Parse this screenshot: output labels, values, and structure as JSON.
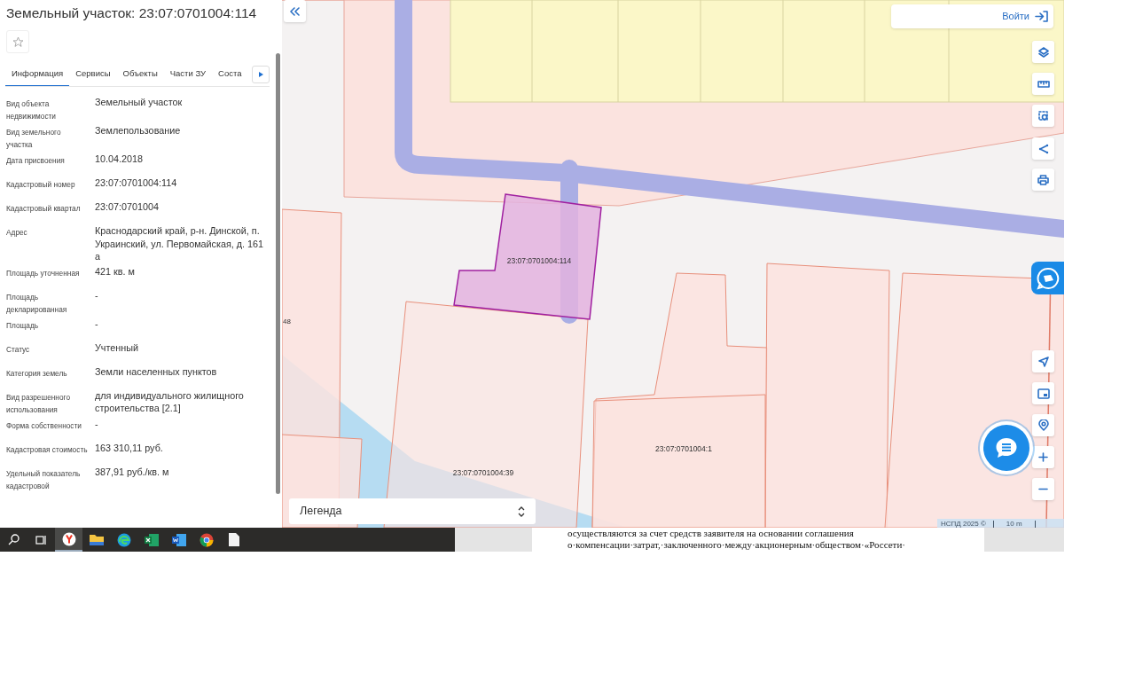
{
  "panel": {
    "title": "Земельный участок: 23:07:0701004:114",
    "favorite": false,
    "tabs": [
      {
        "label": "Информация",
        "selected": true
      },
      {
        "label": "Сервисы",
        "selected": false
      },
      {
        "label": "Объекты",
        "selected": false
      },
      {
        "label": "Части ЗУ",
        "selected": false
      },
      {
        "label": "Соста",
        "selected": false
      }
    ],
    "properties": [
      {
        "label": "Вид объекта недвижимости",
        "value": "Земельный участок"
      },
      {
        "label": "Вид земельного участка",
        "value": "Землепользование"
      },
      {
        "label": "Дата присвоения",
        "value": "10.04.2018"
      },
      {
        "label": "Кадастровый номер",
        "value": "23:07:0701004:114"
      },
      {
        "label": "Кадастровый квартал",
        "value": "23:07:0701004"
      },
      {
        "label": "Адрес",
        "value": "Краснодарский край, р-н. Динской, п. Украинский, ул. Первомайская, д. 161 а"
      },
      {
        "label": "Площадь уточненная",
        "value": "421 кв. м"
      },
      {
        "label": "Площадь декларированная",
        "value": "-"
      },
      {
        "label": "Площадь",
        "value": "-"
      },
      {
        "label": "Статус",
        "value": "Учтенный"
      },
      {
        "label": "Категория земель",
        "value": "Земли населенных пунктов"
      },
      {
        "label": "Вид разрешенного использования",
        "value": "для индивидуального жилищного строительства [2.1]"
      },
      {
        "label": "Форма собственности",
        "value": "-"
      },
      {
        "label": "Кадастровая стоимость",
        "value": "163 310,11 руб."
      },
      {
        "label": "Удельный показатель кадастровой",
        "value": "387,91 руб./кв. м"
      }
    ]
  },
  "map": {
    "login_button": "Войти",
    "edge_label": "48",
    "parcels": [
      {
        "label": "23:07:0701004:114",
        "selected": true
      },
      {
        "label": "23:07:0701004:39",
        "selected": false
      },
      {
        "label": "23:07:0701004:1",
        "selected": false
      }
    ],
    "legend": "Легенда",
    "attribution": "НСПД 2025 ©",
    "scale": "10 m"
  },
  "taskbar": {
    "apps": [
      {
        "kind": "search",
        "selected": false
      },
      {
        "kind": "taskview",
        "selected": false
      },
      {
        "kind": "yandex",
        "selected": true
      },
      {
        "kind": "folder",
        "selected": false
      },
      {
        "kind": "edge",
        "selected": false
      },
      {
        "kind": "excel",
        "selected": false
      },
      {
        "kind": "word",
        "selected": false
      },
      {
        "kind": "chrome",
        "selected": false
      },
      {
        "kind": "file",
        "selected": false
      }
    ]
  },
  "document": {
    "lines": [
      "осуществляются за счет средств заявителя на основании соглашения",
      "о·компенсации·затрат,·заключенного·между·акционерным·обществом·«Россети·"
    ]
  }
}
